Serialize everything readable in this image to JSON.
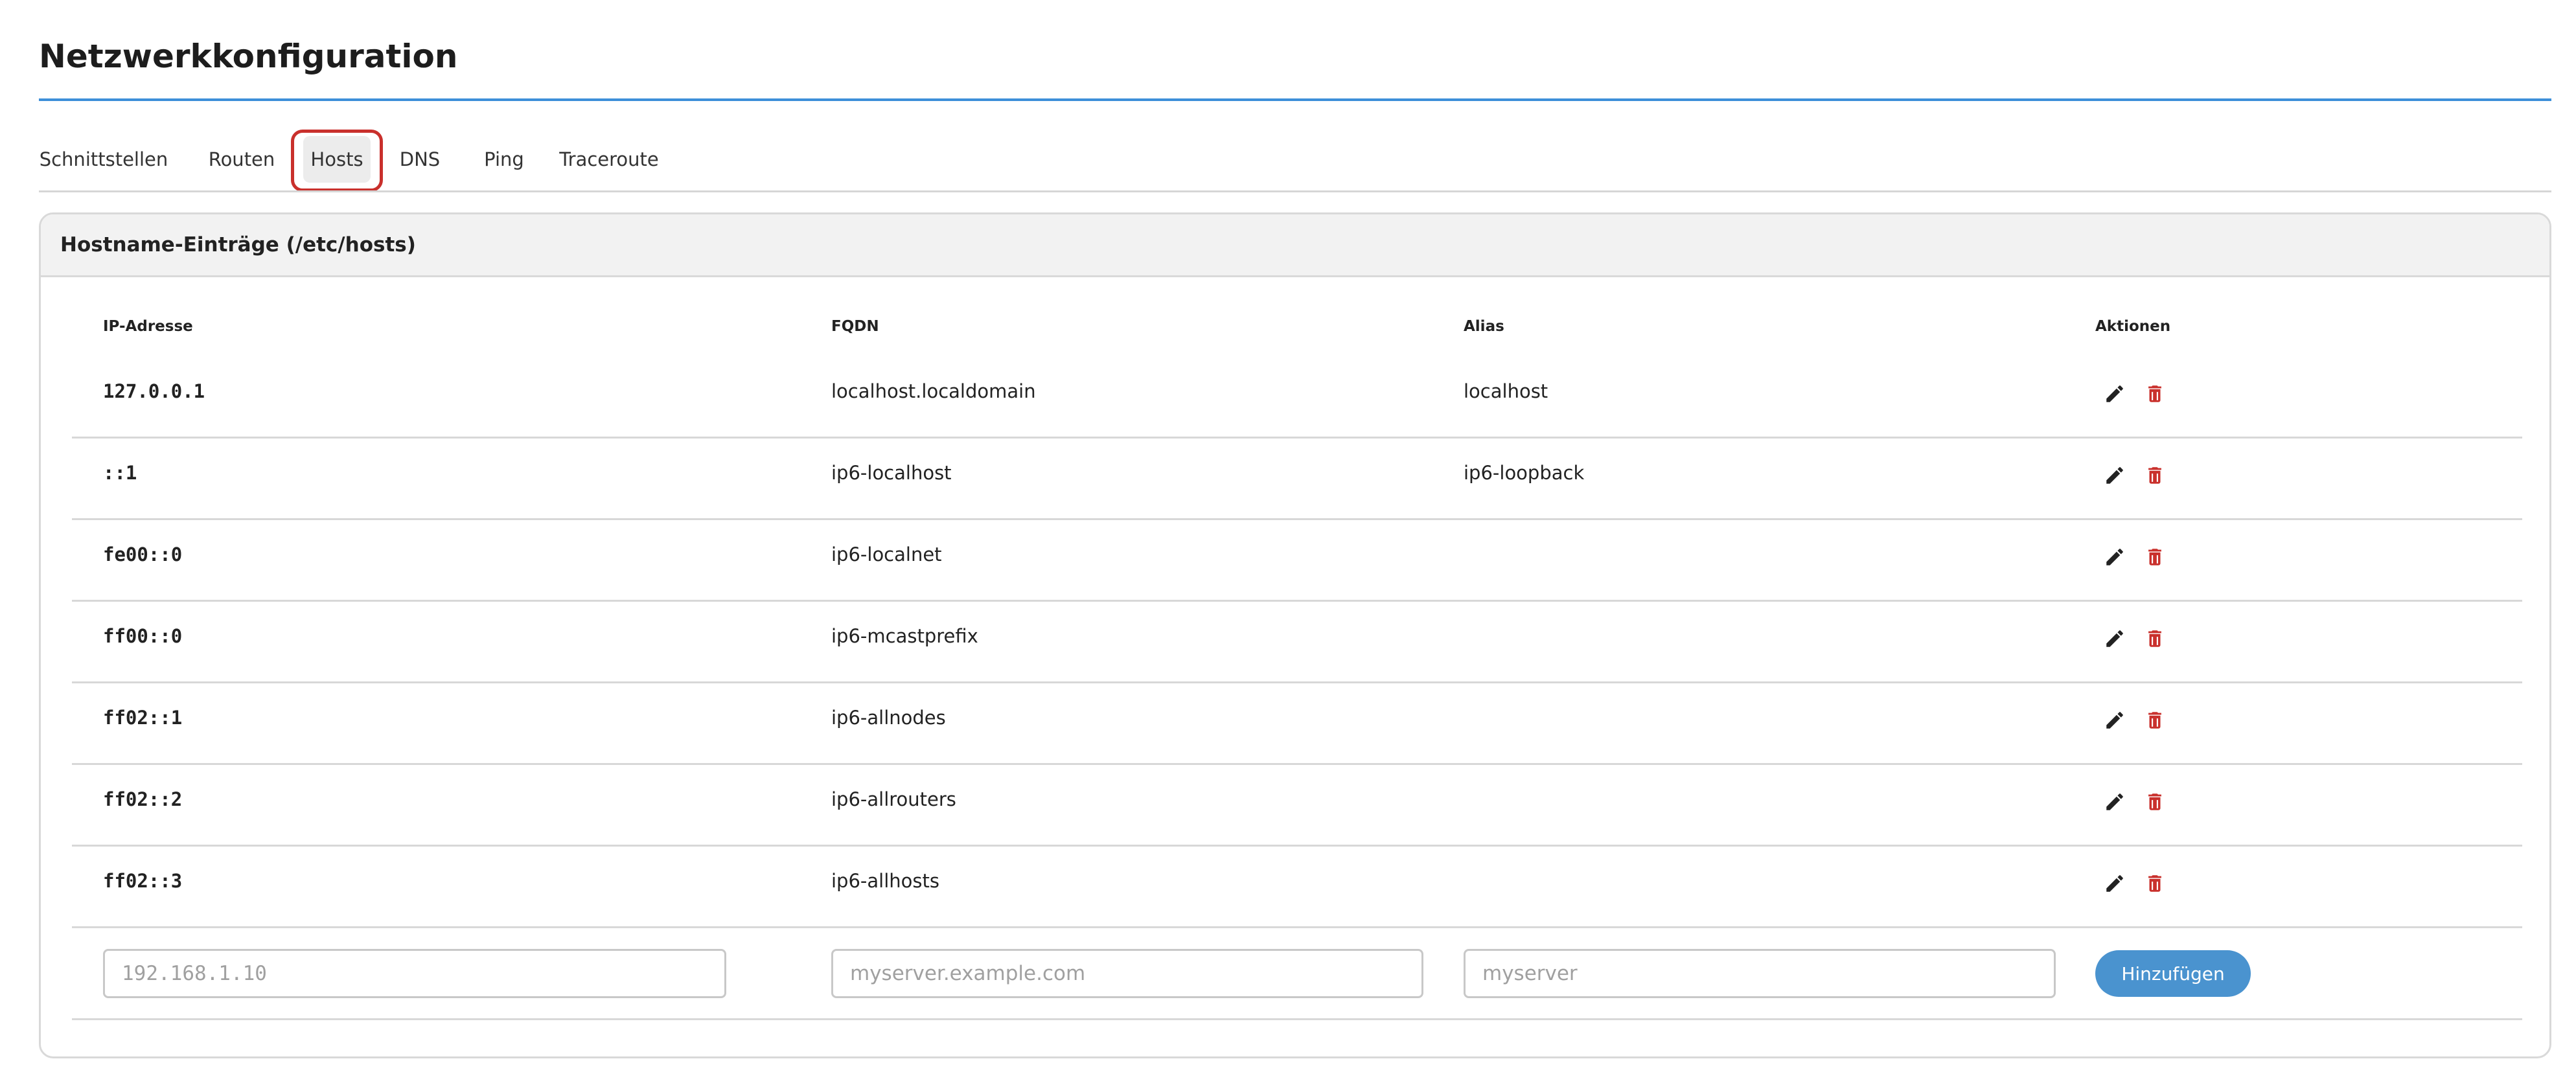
{
  "page": {
    "title": "Netzwerkkonfiguration"
  },
  "tabs": [
    {
      "label": "Schnittstellen",
      "active": false
    },
    {
      "label": "Routen",
      "active": false
    },
    {
      "label": "Hosts",
      "active": true
    },
    {
      "label": "DNS",
      "active": false
    },
    {
      "label": "Ping",
      "active": false
    },
    {
      "label": "Traceroute",
      "active": false
    }
  ],
  "card": {
    "title": "Hostname-Einträge (/etc/hosts)"
  },
  "table": {
    "headers": {
      "ip": "IP-Adresse",
      "fqdn": "FQDN",
      "alias": "Alias",
      "actions": "Aktionen"
    },
    "rows": [
      {
        "ip": "127.0.0.1",
        "fqdn": "localhost.localdomain",
        "alias": "localhost"
      },
      {
        "ip": "::1",
        "fqdn": "ip6-localhost",
        "alias": "ip6-loopback"
      },
      {
        "ip": "fe00::0",
        "fqdn": "ip6-localnet",
        "alias": ""
      },
      {
        "ip": "ff00::0",
        "fqdn": "ip6-mcastprefix",
        "alias": ""
      },
      {
        "ip": "ff02::1",
        "fqdn": "ip6-allnodes",
        "alias": ""
      },
      {
        "ip": "ff02::2",
        "fqdn": "ip6-allrouters",
        "alias": ""
      },
      {
        "ip": "ff02::3",
        "fqdn": "ip6-allhosts",
        "alias": ""
      }
    ],
    "row_icons": {
      "edit": "pencil-icon",
      "delete": "trash-icon"
    }
  },
  "add_form": {
    "ip_placeholder": "192.168.1.10",
    "fqdn_placeholder": "myserver.example.com",
    "alias_placeholder": "myserver",
    "ip_value": "",
    "fqdn_value": "",
    "alias_value": "",
    "add_label": "Hinzufügen"
  },
  "colors": {
    "accent": "#3d8fd9",
    "button": "#4a93cf",
    "delete": "#c9302c",
    "highlight": "#c9302c"
  }
}
